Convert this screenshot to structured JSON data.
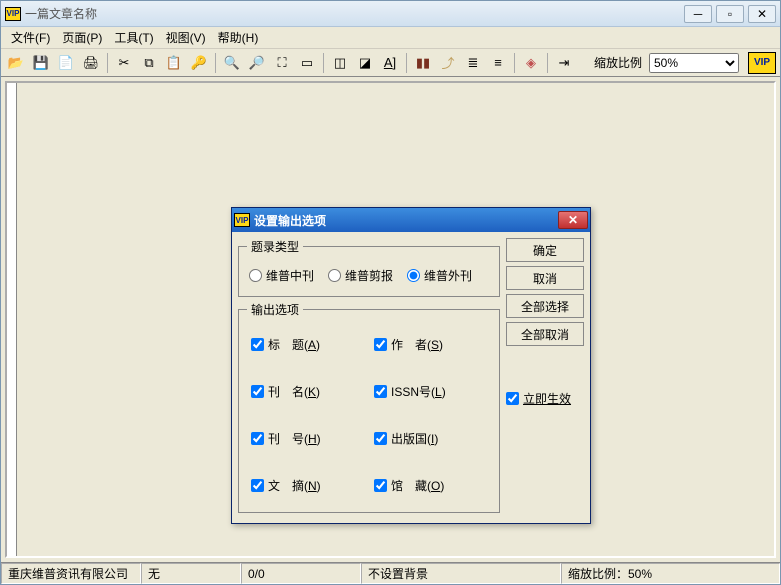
{
  "window": {
    "title": "一篇文章名称"
  },
  "menubar": {
    "file": "文件(F)",
    "page": "页面(P)",
    "tools": "工具(T)",
    "view": "视图(V)",
    "help": "帮助(H)"
  },
  "toolbar": {
    "zoom_label": "缩放比例",
    "zoom_value": "50%"
  },
  "dialog": {
    "title": "设置输出选项",
    "record_type_legend": "题录类型",
    "radio_zhongkan": "维普中刊",
    "radio_jianbao": "维普剪报",
    "radio_waikan": "维普外刊",
    "output_legend": "输出选项",
    "chk_title": "标　题(A)",
    "chk_author": "作　者(S)",
    "chk_journal": "刊　名(K)",
    "chk_issn": "ISSN号(L)",
    "chk_issue": "刊　号(H)",
    "chk_country": "出版国(I)",
    "chk_abstract": "文　摘(N)",
    "chk_collection": "馆　藏(O)",
    "btn_ok": "确定",
    "btn_cancel": "取消",
    "btn_select_all": "全部选择",
    "btn_deselect_all": "全部取消",
    "chk_immediate": "立即生效"
  },
  "statusbar": {
    "company": "重庆维普资讯有限公司",
    "none": "无",
    "pages": "0/0",
    "bg": "不设置背景",
    "zoom": "缩放比例：50%"
  }
}
